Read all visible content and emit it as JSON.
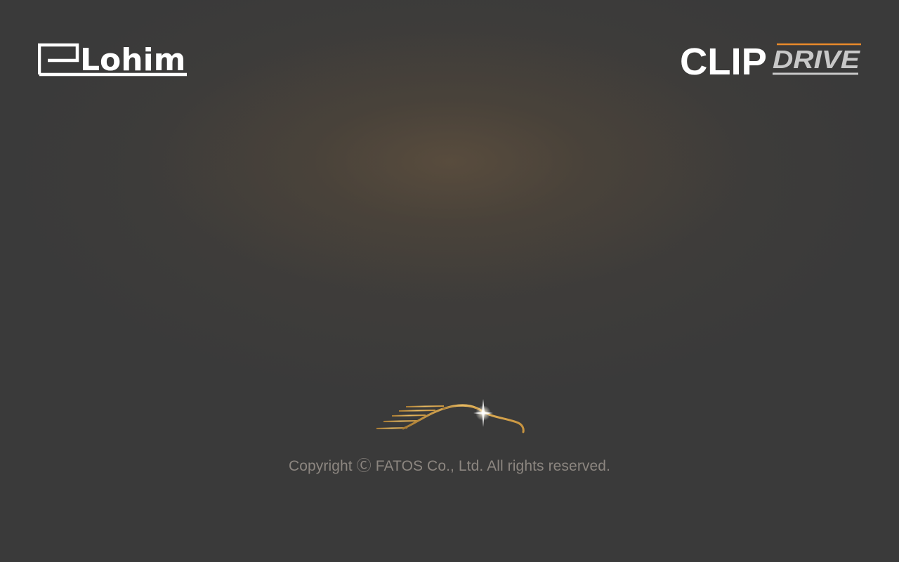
{
  "splash": {
    "left_logo_text": "Lohim",
    "right_logo_clip": "CLIP",
    "right_logo_drive": "DRIVE",
    "car_mark_icon": "car-swoosh-icon",
    "copyright": "Copyright Ⓒ FATOS Co., Ltd.  All rights reserved."
  },
  "colors": {
    "background": "#3a3a3a",
    "glow": "#5c4e3e",
    "logo_white": "#ffffff",
    "drive_accent": "#e8892a",
    "drive_gray": "#c8c8c8",
    "car_gold": "#d9a64f",
    "copyright_text": "#8c8680"
  }
}
